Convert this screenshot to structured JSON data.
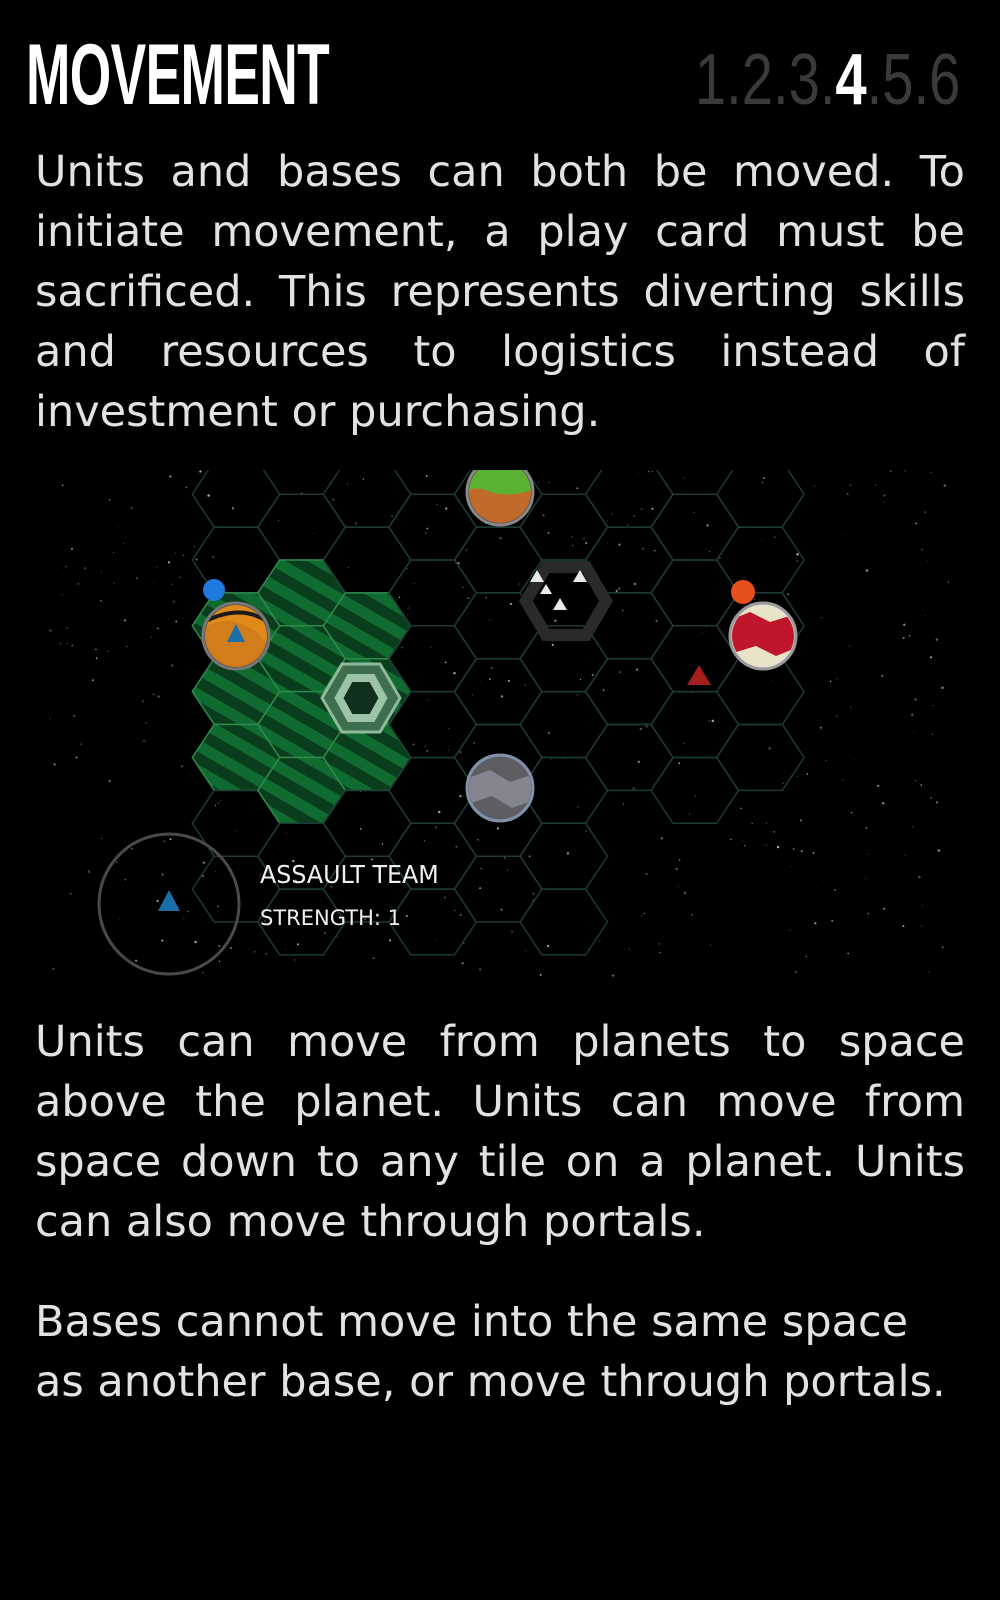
{
  "header": {
    "title": "MOVEMENT",
    "pages": [
      "1",
      "2",
      "3",
      "4",
      "5",
      "6"
    ],
    "current_page": "4"
  },
  "paragraphs": {
    "intro": "Units and bases can both be moved. To initiate movement, a play card must be sacrificed. This represents diverting skills and resources to logistics instead of investment or purchasing.",
    "rules_units": "Units can move from planets to space above the planet. Units can move from space down to any tile on a planet. Units can also move through portals.",
    "rules_bases": "Bases cannot move into the same space as another base, or move through portals."
  },
  "board": {
    "selected_unit": {
      "name": "ASSAULT TEAM",
      "strength": "STRENGTH: 1",
      "icon": "triangle-unit-icon"
    },
    "colors": {
      "player_blue": "#1f7ae0",
      "player_red": "#e5501c",
      "movement_range": "#1f8f45",
      "grid_line": "#1c3a36"
    },
    "planets": [
      "orange-planet",
      "red-planet",
      "green-brown-planet",
      "grey-planet"
    ],
    "portal_icon": "portal-icon"
  }
}
